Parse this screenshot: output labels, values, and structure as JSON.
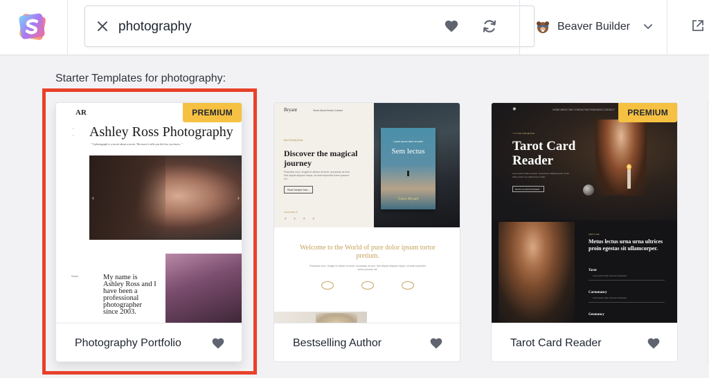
{
  "header": {
    "search": {
      "value": "photography",
      "placeholder": ""
    },
    "builder": {
      "label": "Beaver Builder"
    },
    "icons": {
      "clear": "close-icon",
      "favorite": "heart-icon",
      "sync": "sync-icon",
      "dropdown": "chevron-down-icon",
      "external": "external-link-icon"
    }
  },
  "section_title": "Starter Templates for photography:",
  "cards": [
    {
      "name": "Photography Portfolio",
      "badge": "PREMIUM",
      "selected": true,
      "preview": {
        "logo": "AR",
        "title": "Ashley Ross Photography",
        "tagline": "\" A photograph is a secret about a secret. The more it tells you the less you know. \"",
        "intro": "My name is Ashley Ross and I have been a professional photographer since 2003.",
        "side_label": "Good"
      }
    },
    {
      "name": "Bestselling Author",
      "badge": "",
      "selected": false,
      "preview": {
        "brand": "Bryant",
        "nav": "Home   About   Books   Contact",
        "eyebrow": "Best Selling Book",
        "heading": "Discover the magical journey",
        "para": "Phasellus nunc, feugiat id ultrices sit amet, accumsan at eros. Sed aliquet aliquam neque, sit amet imperdiet lorem posuere vel.",
        "button": "Read Sample Now  →",
        "book_small": "Lorem ipsum dolor sit amet",
        "book_title": "Sem lectus",
        "book_author": "Grace Bryant",
        "featured": "FEATURED IN",
        "logos": "✦ ✦ ✦ ✦",
        "welcome": "Welcome to the World of pure dolor ipsum tortor pretium.",
        "lower_para": "Phasellus nunc, feugiat id ultrices sit amet, accumsan at eros. Sed aliquet aliquam neque, sit amet imperdiet lorem posuere vel."
      }
    },
    {
      "name": "Tarot Card Reader",
      "badge": "PREMIUM",
      "selected": false,
      "preview": {
        "nav": "HOME   ABOUT ME   CONSULTING   READINGS   CONTACT",
        "eyebrow": "✦ IS THE TIME ◆ NOW",
        "title": "Tarot Card Reader",
        "para": "Lorem ipsum dolor sit amet, consectetur adipiscing elit. Ut elit tellus, luctus nec ullamcorper mattis.",
        "button": "BOOK AN APPOINTMENT",
        "eyebrow2": "ABOUT ME",
        "heading2": "Metus lectus urna urna ultrices proin egestas sit ullamcorper.",
        "item1": "Tarot",
        "item2": "Cartomancy",
        "item3": "Geomancy",
        "item_txt": "Lorem ipsum dolor sit amet consectetur"
      }
    }
  ],
  "colors": {
    "highlight": "#e8412a",
    "badge": "#f6c142",
    "icon": "#5f6470"
  }
}
